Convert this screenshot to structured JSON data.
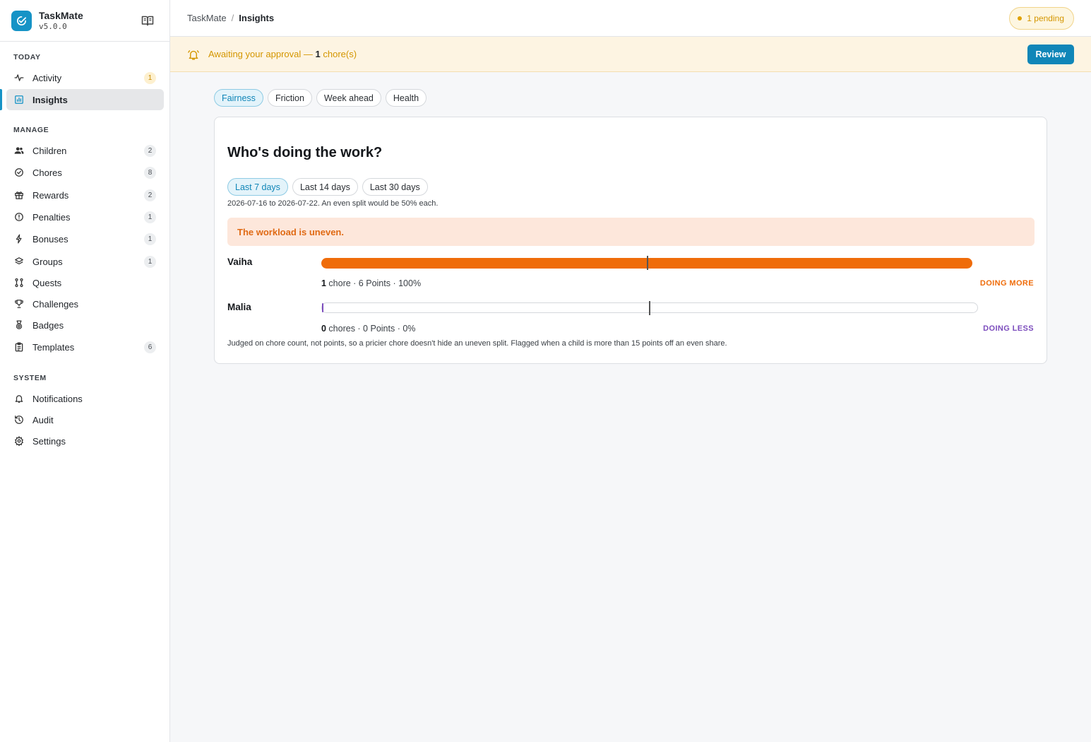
{
  "app": {
    "name": "TaskMate",
    "version": "v5.0.0"
  },
  "sidebar": {
    "sections": [
      {
        "label": "TODAY",
        "items": [
          {
            "label": "Activity",
            "icon": "activity-icon",
            "badge": "1",
            "badge_style": "warn"
          },
          {
            "label": "Insights",
            "icon": "chart-icon",
            "badge": "",
            "active": true
          }
        ]
      },
      {
        "label": "MANAGE",
        "items": [
          {
            "label": "Children",
            "icon": "users-icon",
            "badge": "2"
          },
          {
            "label": "Chores",
            "icon": "check-circle-icon",
            "badge": "8"
          },
          {
            "label": "Rewards",
            "icon": "gift-icon",
            "badge": "2"
          },
          {
            "label": "Penalties",
            "icon": "alert-circle-icon",
            "badge": "1"
          },
          {
            "label": "Bonuses",
            "icon": "bolt-icon",
            "badge": "1"
          },
          {
            "label": "Groups",
            "icon": "layers-icon",
            "badge": "1"
          },
          {
            "label": "Quests",
            "icon": "route-icon",
            "badge": ""
          },
          {
            "label": "Challenges",
            "icon": "trophy-icon",
            "badge": ""
          },
          {
            "label": "Badges",
            "icon": "medal-icon",
            "badge": ""
          },
          {
            "label": "Templates",
            "icon": "clipboard-icon",
            "badge": "6"
          }
        ]
      },
      {
        "label": "SYSTEM",
        "items": [
          {
            "label": "Notifications",
            "icon": "bell-icon",
            "badge": ""
          },
          {
            "label": "Audit",
            "icon": "history-icon",
            "badge": ""
          },
          {
            "label": "Settings",
            "icon": "gear-icon",
            "badge": ""
          }
        ]
      }
    ]
  },
  "topbar": {
    "breadcrumb": [
      "TaskMate",
      "Insights"
    ],
    "separator": "/",
    "pending": "1 pending"
  },
  "banner": {
    "prefix": "Awaiting your approval — ",
    "count": "1",
    "suffix": " chore(s)",
    "button": "Review"
  },
  "tabs": [
    "Fairness",
    "Friction",
    "Week ahead",
    "Health"
  ],
  "fairness": {
    "title": "Who's doing the work?",
    "ranges": [
      "Last 7 days",
      "Last 14 days",
      "Last 30 days"
    ],
    "range_note": "2026-07-16 to 2026-07-22. An even split would be 50% each.",
    "alert": "The workload is uneven.",
    "children": [
      {
        "name": "Vaiha",
        "count": "1",
        "count_unit": " chore",
        "rest": " · 6 Points · 100%",
        "share": 1.0,
        "verdict": "DOING MORE",
        "color": "#ef6c0a"
      },
      {
        "name": "Malia",
        "count": "0",
        "count_unit": " chores",
        "rest": " · 0 Points · 0%",
        "share": 0.0,
        "verdict": "DOING LESS",
        "color": "#7c4dbd"
      }
    ],
    "footnote": "Judged on chore count, not points, so a pricier chore doesn't hide an uneven split. Flagged when a child is more than 15 points off an even share."
  },
  "colors": {
    "accent": "#1693c6",
    "warning": "#d49600",
    "more": "#ef6c0a",
    "less": "#7c4dbd"
  }
}
